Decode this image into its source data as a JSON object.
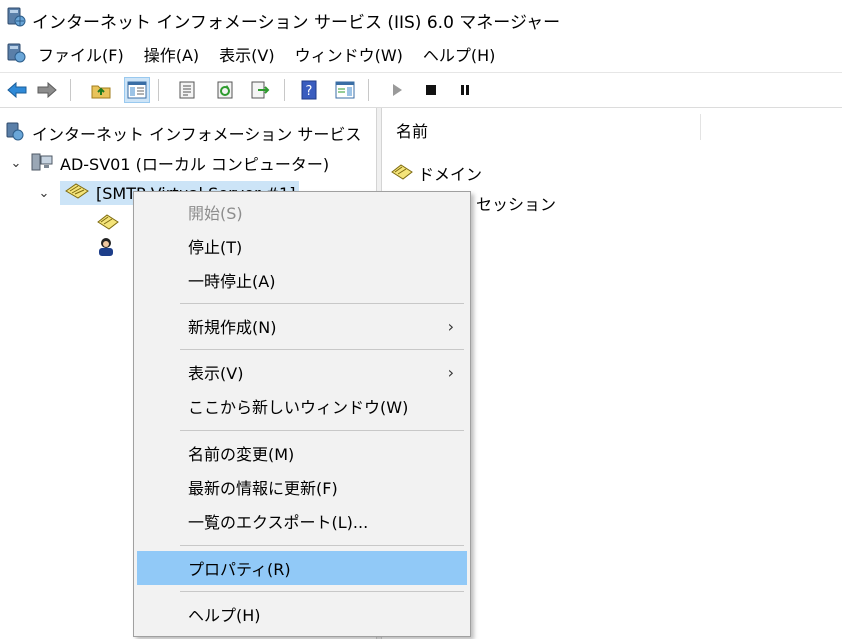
{
  "window": {
    "title": "インターネット インフォメーション サービス (IIS) 6.0 マネージャー"
  },
  "menubar": {
    "items": [
      "ファイル(F)",
      "操作(A)",
      "表示(V)",
      "ウィンドウ(W)",
      "ヘルプ(H)"
    ]
  },
  "toolbar": {
    "buttons": [
      "back",
      "forward",
      "up-folder",
      "show-hide-console-tree",
      "properties",
      "refresh",
      "export-list",
      "help",
      "show-hide-action-pane",
      "start",
      "stop",
      "pause"
    ],
    "active": "show-hide-console-tree"
  },
  "tree": {
    "root": "インターネット インフォメーション サービス",
    "computer": "AD-SV01 (ローカル コンピューター)",
    "server": "[SMTP Virtual Server #1]"
  },
  "list": {
    "column_name": "名前",
    "items": [
      "ドメイン",
      "セッション"
    ]
  },
  "context_menu": {
    "start": "開始(S)",
    "stop": "停止(T)",
    "pause": "一時停止(A)",
    "new": "新規作成(N)",
    "view": "表示(V)",
    "new_window": "ここから新しいウィンドウ(W)",
    "rename": "名前の変更(M)",
    "refresh": "最新の情報に更新(F)",
    "export": "一覧のエクスポート(L)...",
    "properties": "プロパティ(R)",
    "help": "ヘルプ(H)",
    "submenu_arrow": "›"
  },
  "colors": {
    "selection": "#cce4f7",
    "menu_highlight": "#91c9f7",
    "menu_background": "#f2f2f2",
    "disabled_text": "#8d8d8d"
  }
}
